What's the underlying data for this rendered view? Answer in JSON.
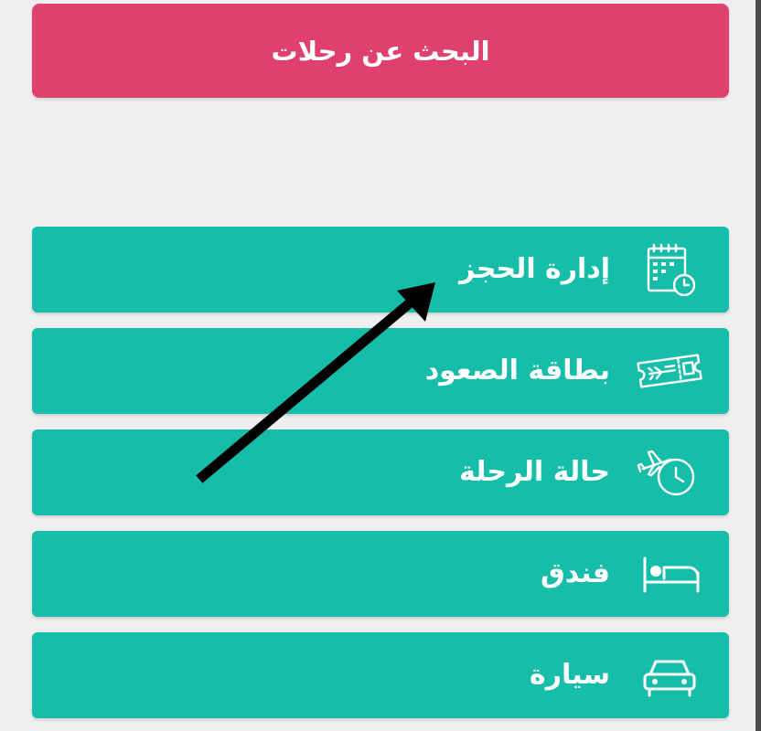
{
  "search_button": {
    "label": "البحث عن رحلات"
  },
  "menu": {
    "items": [
      {
        "label": "إدارة الحجز",
        "icon": "calendar-clock-icon"
      },
      {
        "label": "بطاقة الصعود",
        "icon": "boarding-pass-icon"
      },
      {
        "label": "حالة الرحلة",
        "icon": "plane-clock-icon"
      },
      {
        "label": "فندق",
        "icon": "bed-icon"
      },
      {
        "label": "سيارة",
        "icon": "car-icon"
      }
    ]
  },
  "colors": {
    "search_button_bg": "#e0406e",
    "menu_item_bg": "#16bda9",
    "page_bg": "#efeff0",
    "text": "#ffffff",
    "annotation_arrow": "#000000"
  }
}
